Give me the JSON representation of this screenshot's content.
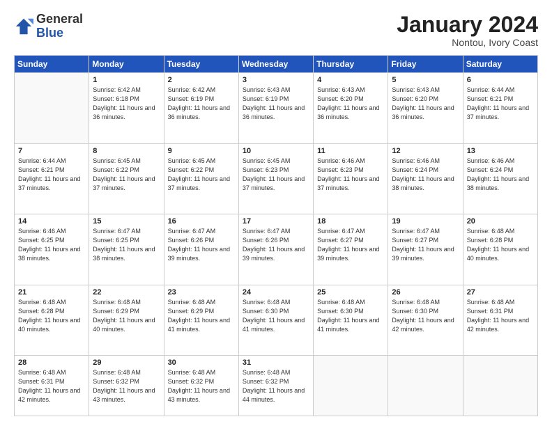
{
  "header": {
    "logo_general": "General",
    "logo_blue": "Blue",
    "month": "January 2024",
    "location": "Nontou, Ivory Coast"
  },
  "days_of_week": [
    "Sunday",
    "Monday",
    "Tuesday",
    "Wednesday",
    "Thursday",
    "Friday",
    "Saturday"
  ],
  "weeks": [
    [
      {
        "day": "",
        "info": ""
      },
      {
        "day": "1",
        "info": "Sunrise: 6:42 AM\nSunset: 6:18 PM\nDaylight: 11 hours and 36 minutes."
      },
      {
        "day": "2",
        "info": "Sunrise: 6:42 AM\nSunset: 6:19 PM\nDaylight: 11 hours and 36 minutes."
      },
      {
        "day": "3",
        "info": "Sunrise: 6:43 AM\nSunset: 6:19 PM\nDaylight: 11 hours and 36 minutes."
      },
      {
        "day": "4",
        "info": "Sunrise: 6:43 AM\nSunset: 6:20 PM\nDaylight: 11 hours and 36 minutes."
      },
      {
        "day": "5",
        "info": "Sunrise: 6:43 AM\nSunset: 6:20 PM\nDaylight: 11 hours and 36 minutes."
      },
      {
        "day": "6",
        "info": "Sunrise: 6:44 AM\nSunset: 6:21 PM\nDaylight: 11 hours and 37 minutes."
      }
    ],
    [
      {
        "day": "7",
        "info": "Sunrise: 6:44 AM\nSunset: 6:21 PM\nDaylight: 11 hours and 37 minutes."
      },
      {
        "day": "8",
        "info": "Sunrise: 6:45 AM\nSunset: 6:22 PM\nDaylight: 11 hours and 37 minutes."
      },
      {
        "day": "9",
        "info": "Sunrise: 6:45 AM\nSunset: 6:22 PM\nDaylight: 11 hours and 37 minutes."
      },
      {
        "day": "10",
        "info": "Sunrise: 6:45 AM\nSunset: 6:23 PM\nDaylight: 11 hours and 37 minutes."
      },
      {
        "day": "11",
        "info": "Sunrise: 6:46 AM\nSunset: 6:23 PM\nDaylight: 11 hours and 37 minutes."
      },
      {
        "day": "12",
        "info": "Sunrise: 6:46 AM\nSunset: 6:24 PM\nDaylight: 11 hours and 38 minutes."
      },
      {
        "day": "13",
        "info": "Sunrise: 6:46 AM\nSunset: 6:24 PM\nDaylight: 11 hours and 38 minutes."
      }
    ],
    [
      {
        "day": "14",
        "info": "Sunrise: 6:46 AM\nSunset: 6:25 PM\nDaylight: 11 hours and 38 minutes."
      },
      {
        "day": "15",
        "info": "Sunrise: 6:47 AM\nSunset: 6:25 PM\nDaylight: 11 hours and 38 minutes."
      },
      {
        "day": "16",
        "info": "Sunrise: 6:47 AM\nSunset: 6:26 PM\nDaylight: 11 hours and 39 minutes."
      },
      {
        "day": "17",
        "info": "Sunrise: 6:47 AM\nSunset: 6:26 PM\nDaylight: 11 hours and 39 minutes."
      },
      {
        "day": "18",
        "info": "Sunrise: 6:47 AM\nSunset: 6:27 PM\nDaylight: 11 hours and 39 minutes."
      },
      {
        "day": "19",
        "info": "Sunrise: 6:47 AM\nSunset: 6:27 PM\nDaylight: 11 hours and 39 minutes."
      },
      {
        "day": "20",
        "info": "Sunrise: 6:48 AM\nSunset: 6:28 PM\nDaylight: 11 hours and 40 minutes."
      }
    ],
    [
      {
        "day": "21",
        "info": "Sunrise: 6:48 AM\nSunset: 6:28 PM\nDaylight: 11 hours and 40 minutes."
      },
      {
        "day": "22",
        "info": "Sunrise: 6:48 AM\nSunset: 6:29 PM\nDaylight: 11 hours and 40 minutes."
      },
      {
        "day": "23",
        "info": "Sunrise: 6:48 AM\nSunset: 6:29 PM\nDaylight: 11 hours and 41 minutes."
      },
      {
        "day": "24",
        "info": "Sunrise: 6:48 AM\nSunset: 6:30 PM\nDaylight: 11 hours and 41 minutes."
      },
      {
        "day": "25",
        "info": "Sunrise: 6:48 AM\nSunset: 6:30 PM\nDaylight: 11 hours and 41 minutes."
      },
      {
        "day": "26",
        "info": "Sunrise: 6:48 AM\nSunset: 6:30 PM\nDaylight: 11 hours and 42 minutes."
      },
      {
        "day": "27",
        "info": "Sunrise: 6:48 AM\nSunset: 6:31 PM\nDaylight: 11 hours and 42 minutes."
      }
    ],
    [
      {
        "day": "28",
        "info": "Sunrise: 6:48 AM\nSunset: 6:31 PM\nDaylight: 11 hours and 42 minutes."
      },
      {
        "day": "29",
        "info": "Sunrise: 6:48 AM\nSunset: 6:32 PM\nDaylight: 11 hours and 43 minutes."
      },
      {
        "day": "30",
        "info": "Sunrise: 6:48 AM\nSunset: 6:32 PM\nDaylight: 11 hours and 43 minutes."
      },
      {
        "day": "31",
        "info": "Sunrise: 6:48 AM\nSunset: 6:32 PM\nDaylight: 11 hours and 44 minutes."
      },
      {
        "day": "",
        "info": ""
      },
      {
        "day": "",
        "info": ""
      },
      {
        "day": "",
        "info": ""
      }
    ]
  ]
}
